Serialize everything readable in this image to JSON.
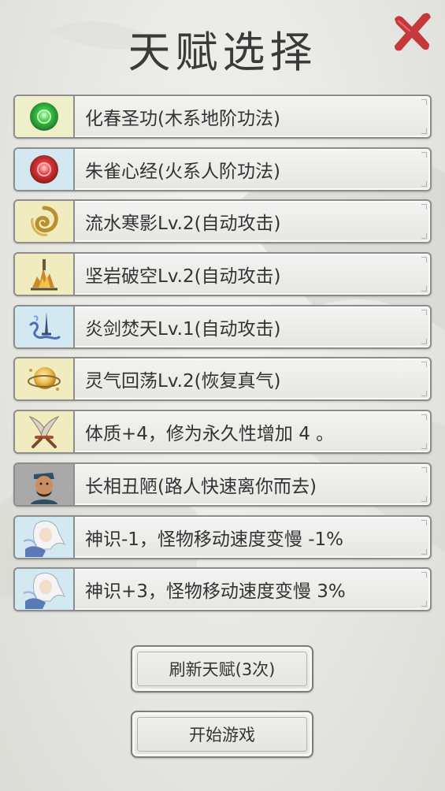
{
  "title": "天赋选择",
  "talents": [
    {
      "label": "化春圣功(木系地阶功法)",
      "icon": "green-orb-icon",
      "bg": "green"
    },
    {
      "label": "朱雀心经(火系人阶功法)",
      "icon": "red-orb-icon",
      "bg": "blue"
    },
    {
      "label": "流水寒影Lv.2(自动攻击)",
      "icon": "swirl-icon",
      "bg": "yellow"
    },
    {
      "label": "坚岩破空Lv.2(自动攻击)",
      "icon": "rock-burst-icon",
      "bg": "yellow"
    },
    {
      "label": "炎剑焚天Lv.1(自动攻击)",
      "icon": "flying-sword-icon",
      "bg": "blue"
    },
    {
      "label": "灵气回荡Lv.2(恢复真气)",
      "icon": "spirit-orb-icon",
      "bg": "yellow"
    },
    {
      "label": "体质+4，修为永久性增加 4 。",
      "icon": "crossed-blades-icon",
      "bg": "yellow"
    },
    {
      "label": "长相丑陋(路人快速离你而去)",
      "icon": "ugly-man-portrait-icon",
      "bg": "gray"
    },
    {
      "label": "神识-1，怪物移动速度变慢 -1%",
      "icon": "white-hair-sage-icon",
      "bg": "blue"
    },
    {
      "label": "神识+3，怪物移动速度变慢 3%",
      "icon": "white-hair-sage-icon",
      "bg": "blue"
    }
  ],
  "buttons": {
    "refresh": "刷新天赋(3次)",
    "start": "开始游戏"
  },
  "close_icon": "red-x-close-icon"
}
